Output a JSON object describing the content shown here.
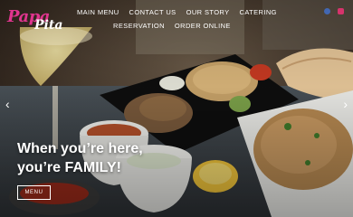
{
  "brand": {
    "logo_word1": "Papa",
    "logo_word2": "Pita"
  },
  "nav": {
    "items": [
      {
        "label": "MAIN MENU"
      },
      {
        "label": "CONTACT US"
      },
      {
        "label": "OUR STORY"
      },
      {
        "label": "CATERING"
      },
      {
        "label": "RESERVATION"
      },
      {
        "label": "ORDER ONLINE"
      }
    ]
  },
  "social": {
    "icons": [
      "facebook-icon",
      "instagram-icon"
    ],
    "colors": {
      "facebook": "#4267b2",
      "instagram": "#d6336c"
    }
  },
  "hero": {
    "headline_line1": "When you’re here,",
    "headline_line2": "you’re FAMILY!",
    "button_label": "MENU",
    "prev_arrow": "‹",
    "next_arrow": "›"
  },
  "colors": {
    "brand_pink": "#e0358e"
  }
}
